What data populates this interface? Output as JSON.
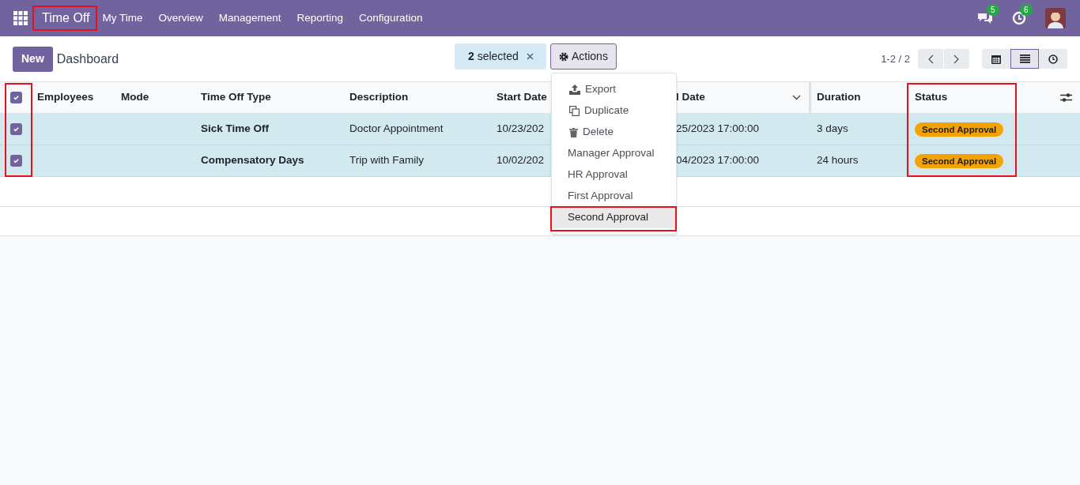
{
  "navbar": {
    "app": "Time Off",
    "menu": [
      "My Time",
      "Overview",
      "Management",
      "Reporting",
      "Configuration"
    ],
    "messages_badge": "5",
    "activities_badge": "6"
  },
  "control_panel": {
    "new_button": "New",
    "breadcrumb": "Dashboard",
    "selection_count": "2",
    "selection_label": "selected",
    "actions_button": "Actions",
    "pager": "1-2 / 2",
    "views": [
      {
        "kind": "calendar",
        "selected": false
      },
      {
        "kind": "list",
        "selected": true
      },
      {
        "kind": "activity",
        "selected": false
      }
    ]
  },
  "actions_menu": [
    {
      "kind": "export",
      "label": "Export",
      "selected": false
    },
    {
      "kind": "duplicate",
      "label": "Duplicate",
      "selected": false
    },
    {
      "kind": "delete",
      "label": "Delete",
      "selected": false
    },
    {
      "kind": "plain",
      "label": "Manager Approval",
      "selected": false
    },
    {
      "kind": "plain",
      "label": "HR Approval",
      "selected": false
    },
    {
      "kind": "plain",
      "label": "First Approval",
      "selected": false
    },
    {
      "kind": "plain",
      "label": "Second Approval",
      "selected": true
    }
  ],
  "table": {
    "all_checked": true,
    "columns": [
      "Employees",
      "Mode",
      "Time Off Type",
      "Description",
      "Start Date",
      "l Date",
      "Duration",
      "Status"
    ],
    "rows": [
      {
        "checked": true,
        "cells": [
          "",
          "",
          "Sick Time Off",
          "Doctor Appointment",
          "10/23/202",
          "25/2023 17:00:00",
          "3 days",
          "Second Approval"
        ]
      },
      {
        "checked": true,
        "cells": [
          "",
          "",
          "Compensatory Days",
          "Trip with Family",
          "10/02/202",
          "04/2023 17:00:00",
          "24 hours",
          "Second Approval"
        ]
      }
    ]
  }
}
